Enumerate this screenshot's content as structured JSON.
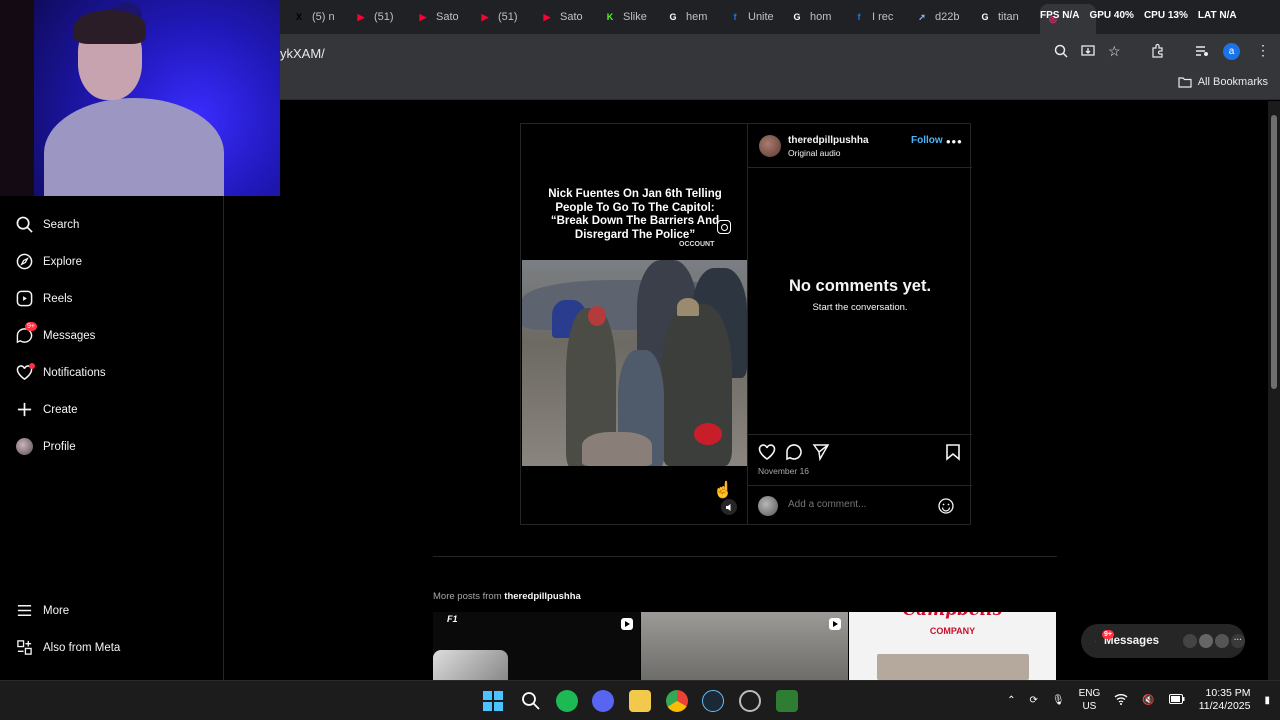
{
  "browser": {
    "tabs": [
      {
        "label": "(5) n",
        "icon": "x-icon",
        "color": "#000000"
      },
      {
        "label": "(51) ",
        "icon": "youtube-icon",
        "color": "#ff0033"
      },
      {
        "label": "Sato",
        "icon": "youtube-icon",
        "color": "#ff0033"
      },
      {
        "label": "(51) ",
        "icon": "youtube-icon",
        "color": "#ff0033"
      },
      {
        "label": "Sato",
        "icon": "youtube-icon",
        "color": "#ff0033"
      },
      {
        "label": "Slike",
        "icon": "kick-icon",
        "color": "#53fc18"
      },
      {
        "label": "hem",
        "icon": "google-icon",
        "color": "#ffffff"
      },
      {
        "label": "Unite",
        "icon": "facebook-icon",
        "color": "#1877f2"
      },
      {
        "label": "hom",
        "icon": "google-icon",
        "color": "#ffffff"
      },
      {
        "label": "I rec",
        "icon": "facebook-icon",
        "color": "#1877f2"
      },
      {
        "label": "d22b",
        "icon": "arrow-icon",
        "color": "#8ab4f8"
      },
      {
        "label": "titan",
        "icon": "google-icon",
        "color": "#ffffff"
      },
      {
        "label": "",
        "icon": "instagram-icon",
        "color": "#e1306c"
      }
    ],
    "url": "ykXAM/",
    "all_bookmarks": "All Bookmarks"
  },
  "overlay_stats": {
    "fps_label": "FPS",
    "fps_value": "N/A",
    "gpu_label": "GPU",
    "gpu_value": "40%",
    "cpu_label": "CPU",
    "cpu_value": "13%",
    "lat_label": "LAT",
    "lat_value": "N/A"
  },
  "sidebar": {
    "items": [
      {
        "label": "Search",
        "icon": "search-icon"
      },
      {
        "label": "Explore",
        "icon": "compass-icon"
      },
      {
        "label": "Reels",
        "icon": "reels-icon"
      },
      {
        "label": "Messages",
        "icon": "messenger-icon",
        "badge": "9+"
      },
      {
        "label": "Notifications",
        "icon": "heart-icon"
      },
      {
        "label": "Create",
        "icon": "plus-icon"
      },
      {
        "label": "Profile",
        "icon": "avatar"
      },
      {
        "label": "More",
        "icon": "menu-icon"
      },
      {
        "label": "Also from Meta",
        "icon": "meta-icon"
      }
    ]
  },
  "post": {
    "overlay_text": "Nick Fuentes On Jan 6th Telling People To Go To The Capitol: “Break Down The Barriers And Disregard The Police”",
    "watermark": "OCCOUNT",
    "username": "theredpillpushha",
    "audio": "Original audio",
    "follow": "Follow",
    "no_comments": "No comments yet.",
    "start_conversation": "Start the conversation.",
    "date": "November 16",
    "comment_placeholder": "Add a comment..."
  },
  "more_posts": {
    "prefix": "More posts from",
    "username": "theredpillpushha",
    "thumb3_text_top": "Campbells",
    "thumb3_text": "COMPANY"
  },
  "messages_pill": {
    "label": "Messages",
    "badge": "9+"
  },
  "taskbar": {
    "lang_line1": "ENG",
    "lang_line2": "US",
    "time": "10:35 PM",
    "date": "11/24/2025"
  }
}
